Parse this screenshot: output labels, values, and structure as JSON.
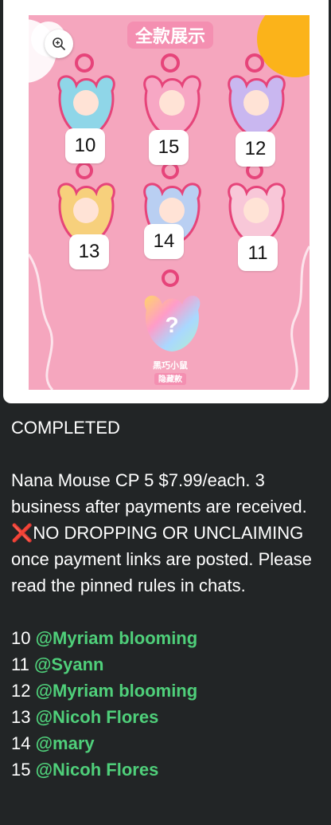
{
  "image_card": {
    "title": "全款展示",
    "bottom_caption_line1": "黑巧小鼠",
    "bottom_caption_line2": "隐藏款",
    "numbers": [
      {
        "value": "10"
      },
      {
        "value": "15"
      },
      {
        "value": "12"
      },
      {
        "value": "13"
      },
      {
        "value": "14"
      },
      {
        "value": "11"
      }
    ],
    "mystery_mark": "?",
    "colors": {
      "background": "#f5a6be",
      "accent_yellow": "#fbb31a"
    }
  },
  "zoom_button": {
    "icon": "zoom-in-icon"
  },
  "caption": {
    "status": "COMPLETED",
    "description_part1": "Nana Mouse CP 5 $7.99/each. 3 business after payments are received.",
    "cross_mark": "❌",
    "description_part2": "NO DROPPING OR UNCLAIMING once payment links are posted. Please read the pinned rules in chats."
  },
  "claims": [
    {
      "number": "10",
      "handle": "@Myriam blooming"
    },
    {
      "number": "11",
      "handle": "@Syann"
    },
    {
      "number": "12",
      "handle": "@Myriam blooming"
    },
    {
      "number": "13",
      "handle": "@Nicoh Flores"
    },
    {
      "number": "14",
      "handle": "@mary"
    },
    {
      "number": "15",
      "handle": "@Nicoh Flores"
    }
  ],
  "colors": {
    "handle": "#4fcf7a",
    "background": "#222526"
  }
}
